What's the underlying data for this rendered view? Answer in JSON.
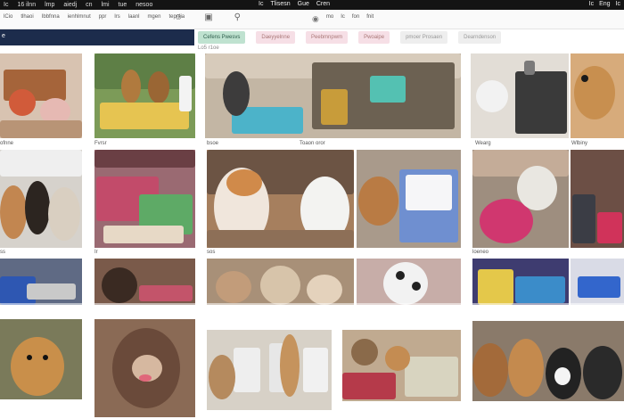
{
  "topbar": {
    "left_items": [
      "Ic",
      "16 ilnn",
      "lmp",
      "aiedj",
      "cn",
      "lmi",
      "tue",
      "nesoo"
    ],
    "mid_items": [
      "Ic",
      "Tlisesn",
      "Gue",
      "Cren"
    ],
    "right_items": [
      "Ic",
      "Eng",
      "Ic"
    ]
  },
  "header": {
    "nav_items": [
      "lCio",
      "tlhaoi",
      "Ibbfnna",
      "ienhlmnut",
      "ppr",
      "lrs",
      "laanl",
      "mgen",
      "tepnlia"
    ],
    "links": [
      "mo",
      "Ic",
      "fon",
      "fnit"
    ]
  },
  "blueband": {
    "text": "e"
  },
  "chips": [
    {
      "label": "Cefens Pwesvs",
      "style": "green"
    },
    {
      "label": "Daeyyelnne",
      "style": "pink"
    },
    {
      "label": "Peebmnpwm",
      "style": "pink"
    },
    {
      "label": "Pwoaipe",
      "style": "pink"
    },
    {
      "label": "pmoer Prosaen",
      "style": "gray"
    },
    {
      "label": "Dearndenson",
      "style": "gray"
    }
  ],
  "subrow": {
    "text": "Lo5 r1oe"
  },
  "captions": {
    "row1": [
      "ofnne",
      "Fvrsr",
      "bsoe",
      "Toaon oror",
      "Wearg",
      "Wlbiny"
    ],
    "row2": [
      "ss",
      "Ir",
      "sos",
      "loeneo"
    ]
  },
  "colors": {
    "accent_navy": "#1c2c4c",
    "chip_green": "#bfe2d0",
    "chip_pink": "#f6dfe6"
  }
}
